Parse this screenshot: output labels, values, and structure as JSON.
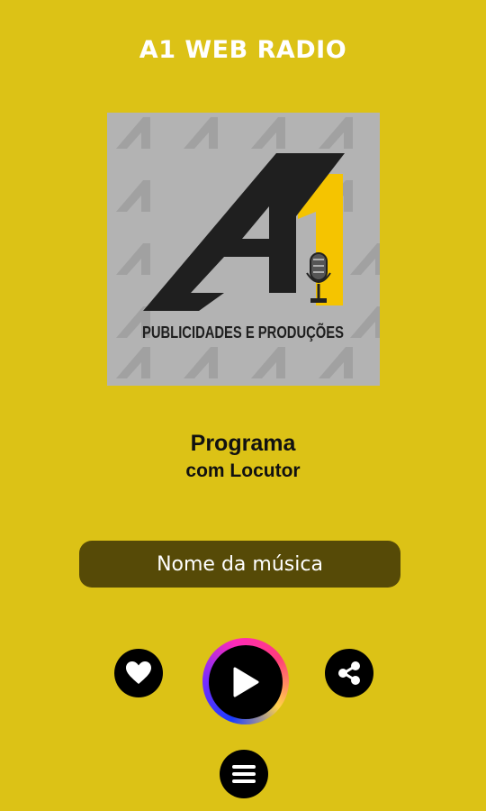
{
  "app": {
    "title": "A1 WEB RADIO"
  },
  "cover": {
    "logo_text": "A1",
    "brand_subtitle": "PUBLICIDADES E PRODUÇÕES",
    "background_color": "#b3b3b3",
    "accent_color": "#f5c400"
  },
  "program": {
    "name": "Programa",
    "host": "com Locutor"
  },
  "now_playing": {
    "song": "Nome da música"
  },
  "controls": {
    "like_icon": "heart-icon",
    "play_icon": "play-icon",
    "share_icon": "share-icon",
    "menu_icon": "menu-icon"
  },
  "colors": {
    "background": "#dcc216",
    "song_bar": "#564a07",
    "button": "#000000"
  }
}
